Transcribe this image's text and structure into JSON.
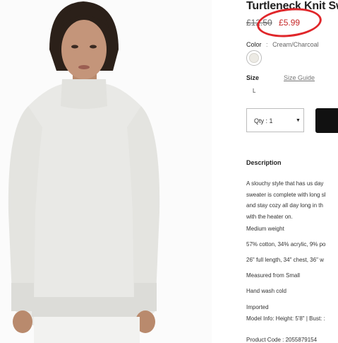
{
  "product": {
    "title": "Turtleneck Knit Sw",
    "old_price": "£12.50",
    "new_price": "£5.99"
  },
  "color": {
    "label": "Color",
    "separator": ":",
    "value": "Cream/Charcoal"
  },
  "size": {
    "label": "Size",
    "guide_link": "Size Guide",
    "options": [
      "L"
    ]
  },
  "quantity": {
    "label": "Qty : 1"
  },
  "description": {
    "heading": "Description",
    "lines": [
      "A slouchy style that has us day",
      "sweater is complete with long sl",
      "and stay cozy all day long in th",
      "with the heater on."
    ],
    "specs": [
      "Medium weight",
      "57% cotton, 34% acrylic, 9% po",
      "26\" full length, 34\" chest, 36\" w",
      "Measured from Small",
      "Hand wash cold",
      "Imported",
      "Model Info: Height: 5'8\" | Bust: :"
    ],
    "product_code": "Product Code : 2055879154"
  },
  "colors": {
    "price_red": "#c62828",
    "annotation_red": "#e0262a",
    "button_black": "#111111"
  }
}
